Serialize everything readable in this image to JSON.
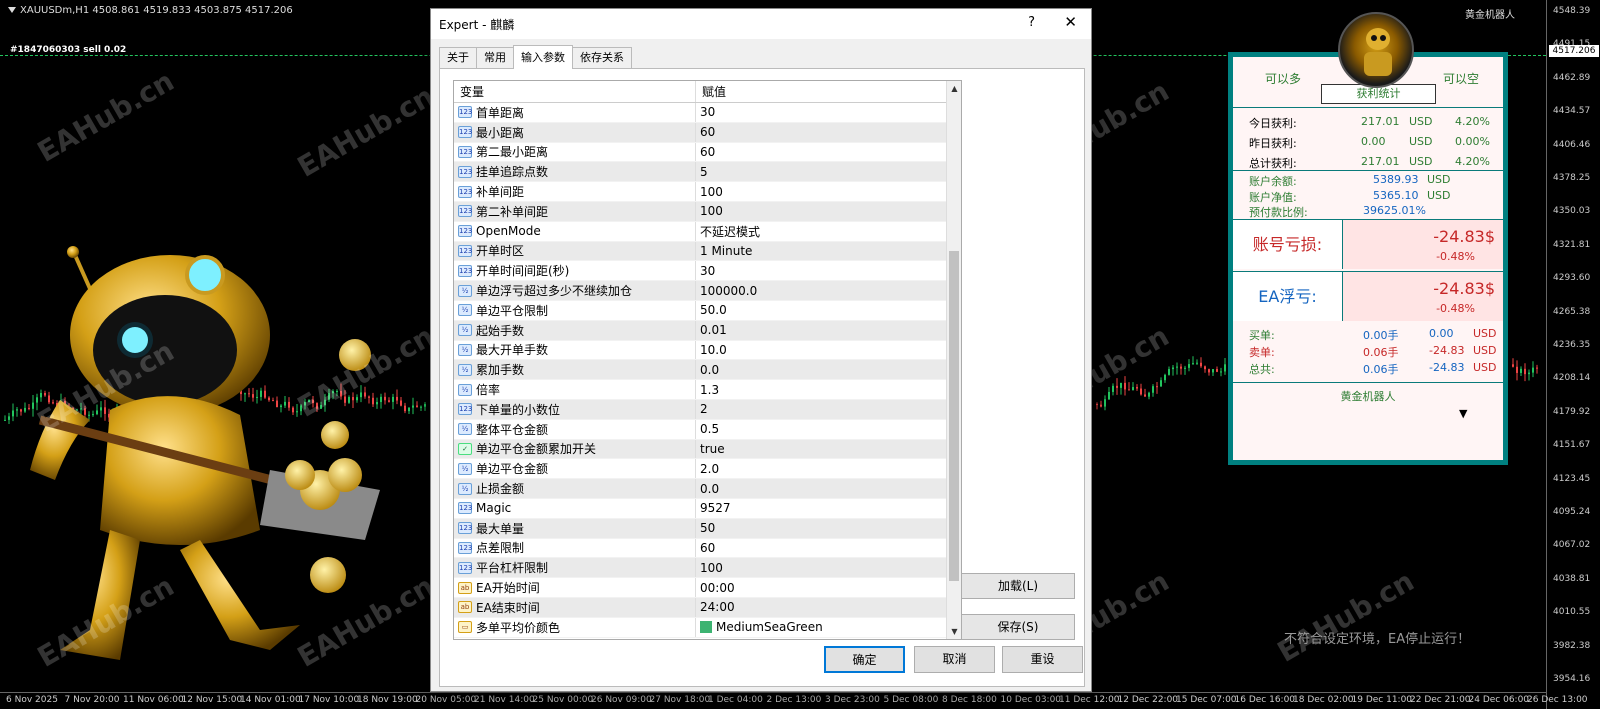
{
  "chart": {
    "title": "XAUUSDm,H1  4508.861 4519.833 4503.875 4517.206",
    "order_label": "#1847060303 sell 0.02",
    "brand": "黄金机器人",
    "current_price": "4517.206",
    "price_ticks": [
      "4548.39",
      "4491.15",
      "4462.89",
      "4434.57",
      "4406.46",
      "4378.25",
      "4350.03",
      "4321.81",
      "4293.60",
      "4265.38",
      "4236.35",
      "4208.14",
      "4179.92",
      "4151.67",
      "4123.45",
      "4095.24",
      "4067.02",
      "4038.81",
      "4010.55",
      "3982.38",
      "3954.16"
    ],
    "time_ticks": [
      "6 Nov 2025",
      "7 Nov 20:00",
      "11 Nov 06:00",
      "12 Nov 15:00",
      "14 Nov 01:00",
      "17 Nov 10:00",
      "18 Nov 19:00",
      "20 Nov 05:00",
      "21 Nov 14:00",
      "25 Nov 00:00",
      "26 Nov 09:00",
      "27 Nov 18:00",
      "1 Dec 04:00",
      "2 Dec 13:00",
      "3 Dec 23:00",
      "5 Dec 08:00",
      "8 Dec 18:00",
      "10 Dec 03:00",
      "11 Dec 12:00",
      "12 Dec 22:00",
      "15 Dec 07:00",
      "16 Dec 16:00",
      "18 Dec 02:00",
      "19 Dec 11:00",
      "22 Dec 21:00",
      "24 Dec 06:00",
      "26 Dec 13:00"
    ],
    "watermark": "EAHub.cn",
    "stop_message": "不符合设定环境，EA停止运行！"
  },
  "dialog": {
    "title": "Expert - 麒麟",
    "help": "?",
    "close": "✕",
    "tabs": [
      "关于",
      "常用",
      "输入参数",
      "依存关系"
    ],
    "col_var": "变量",
    "col_val": "赋值",
    "params": [
      {
        "type": "123",
        "name": "首单距离",
        "value": "30"
      },
      {
        "type": "123",
        "name": "最小距离",
        "value": "60"
      },
      {
        "type": "123",
        "name": "第二最小距离",
        "value": "60"
      },
      {
        "type": "123",
        "name": "挂单追踪点数",
        "value": "5"
      },
      {
        "type": "123",
        "name": "补单间距",
        "value": "100"
      },
      {
        "type": "123",
        "name": "第二补单间距",
        "value": "100"
      },
      {
        "type": "123",
        "name": "OpenMode",
        "value": "不延迟模式"
      },
      {
        "type": "123",
        "name": "开单时区",
        "value": "1 Minute"
      },
      {
        "type": "123",
        "name": "开单时间间距(秒)",
        "value": "30"
      },
      {
        "type": "½",
        "name": "单边浮亏超过多少不继续加仓",
        "value": "100000.0"
      },
      {
        "type": "½",
        "name": "单边平仓限制",
        "value": "50.0"
      },
      {
        "type": "½",
        "name": "起始手数",
        "value": "0.01"
      },
      {
        "type": "½",
        "name": "最大开单手数",
        "value": "10.0"
      },
      {
        "type": "½",
        "name": "累加手数",
        "value": "0.0"
      },
      {
        "type": "½",
        "name": "倍率",
        "value": "1.3"
      },
      {
        "type": "123",
        "name": "下单量的小数位",
        "value": "2"
      },
      {
        "type": "½",
        "name": "整体平仓金额",
        "value": "0.5"
      },
      {
        "type": "bool",
        "name": "单边平仓金额累加开关",
        "value": "true"
      },
      {
        "type": "½",
        "name": "单边平仓金额",
        "value": "2.0"
      },
      {
        "type": "½",
        "name": "止损金额",
        "value": "0.0"
      },
      {
        "type": "123",
        "name": "Magic",
        "value": "9527"
      },
      {
        "type": "123",
        "name": "最大单量",
        "value": "50"
      },
      {
        "type": "123",
        "name": "点差限制",
        "value": "60"
      },
      {
        "type": "123",
        "name": "平台杠杆限制",
        "value": "100"
      },
      {
        "type": "ab",
        "name": "EA开始时间",
        "value": "00:00"
      },
      {
        "type": "ab",
        "name": "EA结束时间",
        "value": "24:00"
      },
      {
        "type": "col",
        "name": "多单平均价颜色",
        "value": "MediumSeaGreen"
      }
    ],
    "load_button": "加载(L)",
    "save_button": "保存(S)",
    "ok_button": "确定",
    "cancel_button": "取消",
    "reset_button": "重设"
  },
  "panel": {
    "can_long": "可以多",
    "can_short": "可以空",
    "stats_title": "获利统计",
    "profit_rows": [
      {
        "label": "今日获利:",
        "amount": "217.01",
        "currency": "USD",
        "pct": "4.20%"
      },
      {
        "label": "昨日获利:",
        "amount": "0.00",
        "currency": "USD",
        "pct": "0.00%"
      },
      {
        "label": "总计获利:",
        "amount": "217.01",
        "currency": "USD",
        "pct": "4.20%"
      }
    ],
    "account_rows": [
      {
        "label": "账户余额:",
        "value": "5389.93",
        "currency": "USD"
      },
      {
        "label": "账户净值:",
        "value": "5365.10",
        "currency": "USD"
      },
      {
        "label": "预付款比例:",
        "value": "39625.01%",
        "currency": ""
      }
    ],
    "account_loss_label": "账号亏损:",
    "account_loss_value": "-24.83$",
    "account_loss_pct": "-0.48%",
    "ea_float_label": "EA浮亏:",
    "ea_float_value": "-24.83$",
    "ea_float_pct": "-0.48%",
    "orders": [
      {
        "label": "买单:",
        "lots": "0.00手",
        "amount": "0.00",
        "currency": "USD"
      },
      {
        "label": "卖单:",
        "lots": "0.06手",
        "amount": "-24.83",
        "currency": "USD"
      },
      {
        "label": "总共:",
        "lots": "0.06手",
        "amount": "-24.83",
        "currency": "USD"
      }
    ],
    "footer": "黄金机器人",
    "dropdown_arrow": "▼"
  },
  "colors": {
    "panel_border": "#008080",
    "loss_red": "#c62828",
    "profit_green": "#2e7d32",
    "order_line": "#22c55e",
    "swatch": "#3CB371"
  }
}
